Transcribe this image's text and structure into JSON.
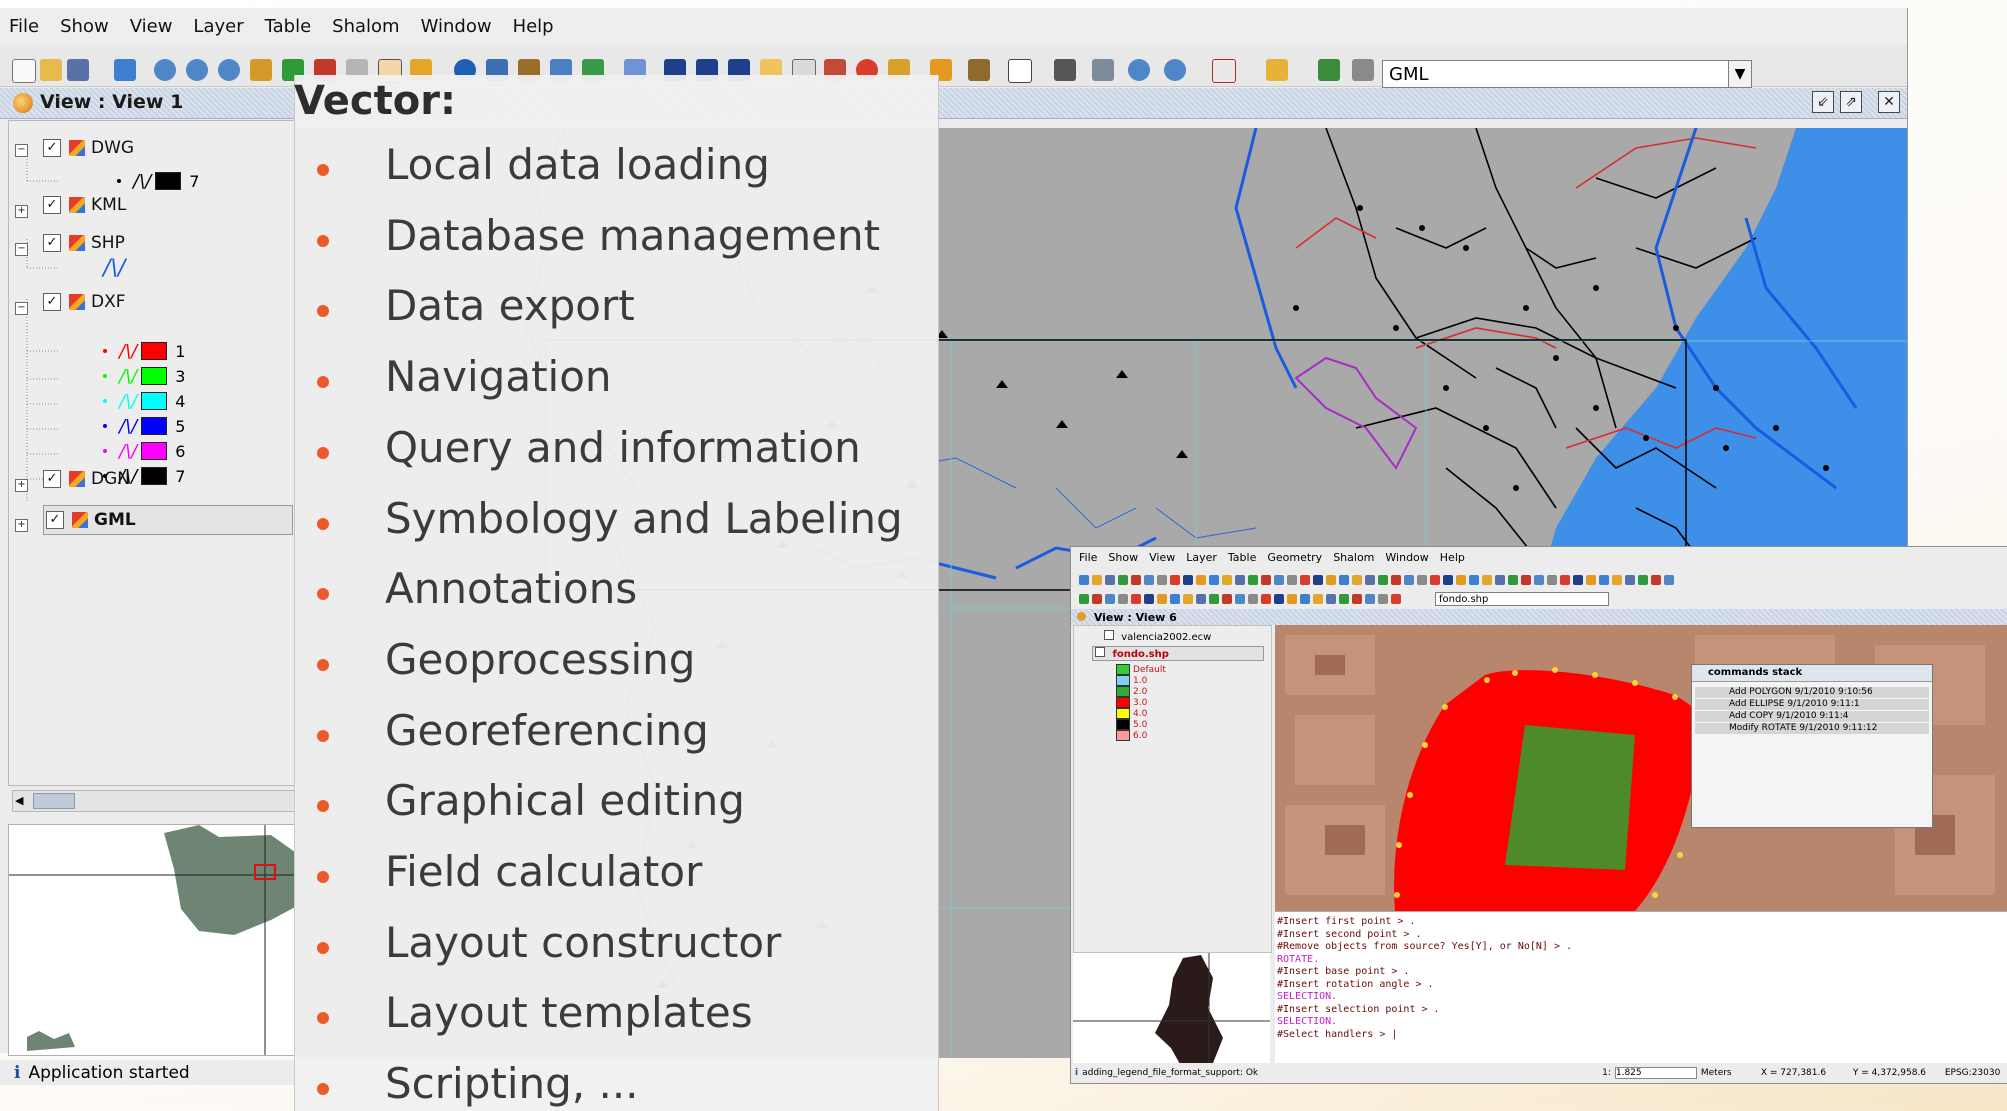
{
  "menubar": [
    "File",
    "Show",
    "View",
    "Layer",
    "Table",
    "Shalom",
    "Window",
    "Help"
  ],
  "toolbar": {
    "layer_combo_value": "GML"
  },
  "view": {
    "title": "View : View 1"
  },
  "toc": {
    "layers": [
      {
        "name": "DWG",
        "expanded": true
      },
      {
        "name": "KML",
        "expanded": false
      },
      {
        "name": "SHP",
        "expanded": true
      },
      {
        "name": "DXF",
        "expanded": true
      },
      {
        "name": "DGN",
        "expanded": false
      },
      {
        "name": "GML",
        "expanded": false,
        "selected": true
      }
    ],
    "dwg_symbol_label": "7",
    "dxf_symbols": [
      {
        "label": "1",
        "color": "#ff0000"
      },
      {
        "label": "3",
        "color": "#00ff00"
      },
      {
        "label": "4",
        "color": "#00ffff"
      },
      {
        "label": "5",
        "color": "#0000ff"
      },
      {
        "label": "6",
        "color": "#ff00ff"
      },
      {
        "label": "7",
        "color": "#000000"
      }
    ]
  },
  "status": {
    "text": "Application started",
    "icon": "info-icon"
  },
  "overlay": {
    "title": "Vector:",
    "items": [
      "Local data loading",
      "Database management",
      "Data export",
      "Navigation",
      "Query and information",
      "Symbology and Labeling",
      "Annotations",
      "Geoprocessing",
      "Georeferencing",
      "Graphical editing",
      "Field calculator",
      "Layout constructor",
      "Layout templates",
      "Scripting, ..."
    ],
    "bullet_color": "#ec5a29"
  },
  "window2": {
    "menu": [
      "File",
      "Show",
      "View",
      "Layer",
      "Table",
      "Geometry",
      "Shalom",
      "Window",
      "Help"
    ],
    "combo_value": "fondo.shp",
    "view_title": "View : View 6",
    "layers": [
      "valencia2002.ecw",
      "fondo.shp"
    ],
    "legend": [
      {
        "label": "Default",
        "color": "#33cc33"
      },
      {
        "label": "1.0",
        "color": "#7fd3f0"
      },
      {
        "label": "2.0",
        "color": "#33aa33"
      },
      {
        "label": "3.0",
        "color": "#ff0000"
      },
      {
        "label": "4.0",
        "color": "#ffff00"
      },
      {
        "label": "5.0",
        "color": "#000000"
      },
      {
        "label": "6.0",
        "color": "#ff9999"
      }
    ],
    "commands_stack": {
      "title": "commands stack",
      "items": [
        "Add POLYGON 9/1/2010 9:10:56",
        "Add ELLIPSE 9/1/2010 9:11:1",
        "Add COPY 9/1/2010 9:11:4",
        "Modify ROTATE 9/1/2010 9:11:12"
      ]
    },
    "console": [
      {
        "text": "#Insert first point > .",
        "kind": "cmd"
      },
      {
        "text": "#Insert second point > .",
        "kind": "cmd"
      },
      {
        "text": "#Remove objects from source? Yes[Y], or No[N] > .",
        "kind": "cmd"
      },
      {
        "text": "ROTATE.",
        "kind": "out"
      },
      {
        "text": "#Insert base point > .",
        "kind": "cmd"
      },
      {
        "text": "#Insert rotation angle > .",
        "kind": "cmd"
      },
      {
        "text": "SELECTION.",
        "kind": "out"
      },
      {
        "text": "#Insert selection point > .",
        "kind": "cmd"
      },
      {
        "text": "SELECTION.",
        "kind": "out"
      },
      {
        "text": "#Select handlers > |",
        "kind": "cmd"
      }
    ],
    "status_left": "adding_legend_file_format_support: Ok",
    "scale_prefix": "1:",
    "scale_value": "1.825",
    "units": "Meters",
    "x_coord": "X = 727,381.6",
    "y_coord": "Y = 4,372,958.6",
    "epsg": "EPSG:23030"
  }
}
